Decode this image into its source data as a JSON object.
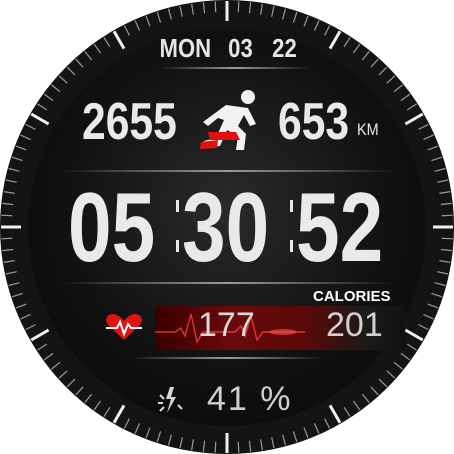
{
  "date": {
    "weekday": "MON",
    "day": "03",
    "month": "22"
  },
  "stats": {
    "steps": "2655",
    "distance": "653",
    "distance_unit": "KM"
  },
  "time": {
    "hours": "05",
    "minutes": "30",
    "seconds": "52"
  },
  "heart_rate": {
    "value": "177"
  },
  "calories": {
    "label": "CALORIES",
    "value": "201"
  },
  "battery": {
    "value": "41 %"
  },
  "icons": {
    "runner": "runner-icon",
    "heart": "heart-rate-icon",
    "battery": "battery-bolt-icon"
  },
  "colors": {
    "accent": "#d81414",
    "text": "#e9e9e9",
    "background": "#111111"
  }
}
